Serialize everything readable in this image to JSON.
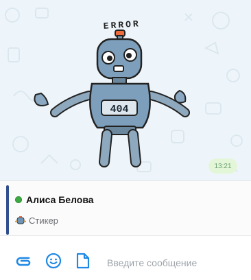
{
  "sticker": {
    "error_text": "ERROR",
    "chest_display": "404",
    "time": "13:21"
  },
  "reply": {
    "sender_name": "Алиса Белова",
    "preview_text": "Стикер"
  },
  "composer": {
    "placeholder": "Введите сообщение",
    "value": ""
  },
  "colors": {
    "accent": "#1e88e5",
    "reply_bar": "#2f4d8c",
    "online": "#3daa44",
    "chat_background": "#eef5fa",
    "time_bubble": "#e3f6d8"
  },
  "icons": [
    "attach-icon",
    "emoji-icon",
    "file-icon",
    "online-status-icon",
    "sticker-preview-icon"
  ]
}
